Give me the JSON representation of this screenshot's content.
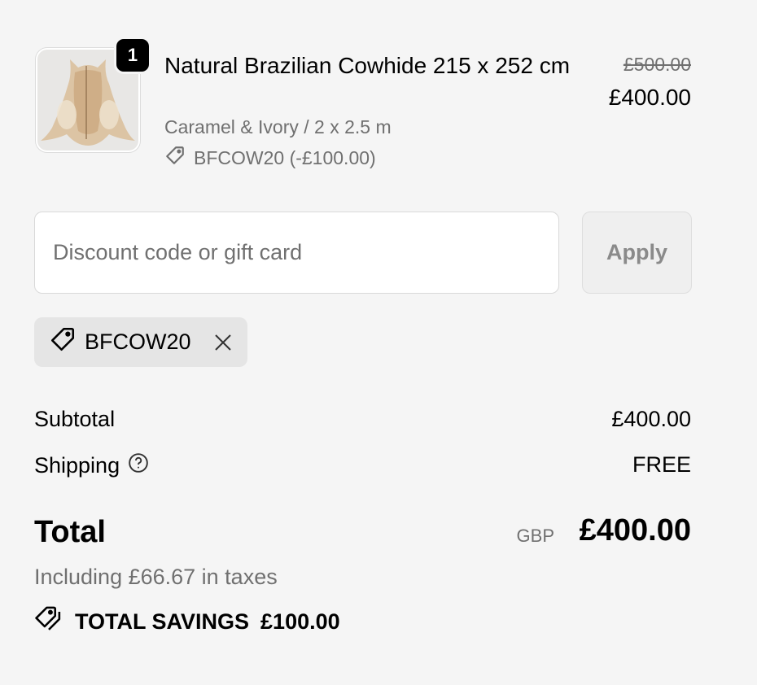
{
  "product": {
    "quantity": "1",
    "name": "Natural Brazilian Cowhide 215 x 252 cm",
    "variant": "Caramel & Ivory / 2 x 2.5 m",
    "discount_line": "BFCOW20 (-£100.00)",
    "price_original": "£500.00",
    "price_current": "£400.00",
    "image_icon": "cowhide-rug-thumbnail"
  },
  "discount": {
    "placeholder": "Discount code or gift card",
    "value": "",
    "apply_label": "Apply",
    "applied_code": "BFCOW20"
  },
  "summary": {
    "subtotal_label": "Subtotal",
    "subtotal_value": "£400.00",
    "shipping_label": "Shipping",
    "shipping_value": "FREE",
    "total_label": "Total",
    "total_currency": "GBP",
    "total_value": "£400.00",
    "tax_note": "Including £66.67 in taxes",
    "savings_label": "TOTAL SAVINGS",
    "savings_value": "£100.00"
  },
  "colors": {
    "background": "#f5f5f5",
    "muted_text": "#707070",
    "chip_background": "#e5e5e5"
  }
}
